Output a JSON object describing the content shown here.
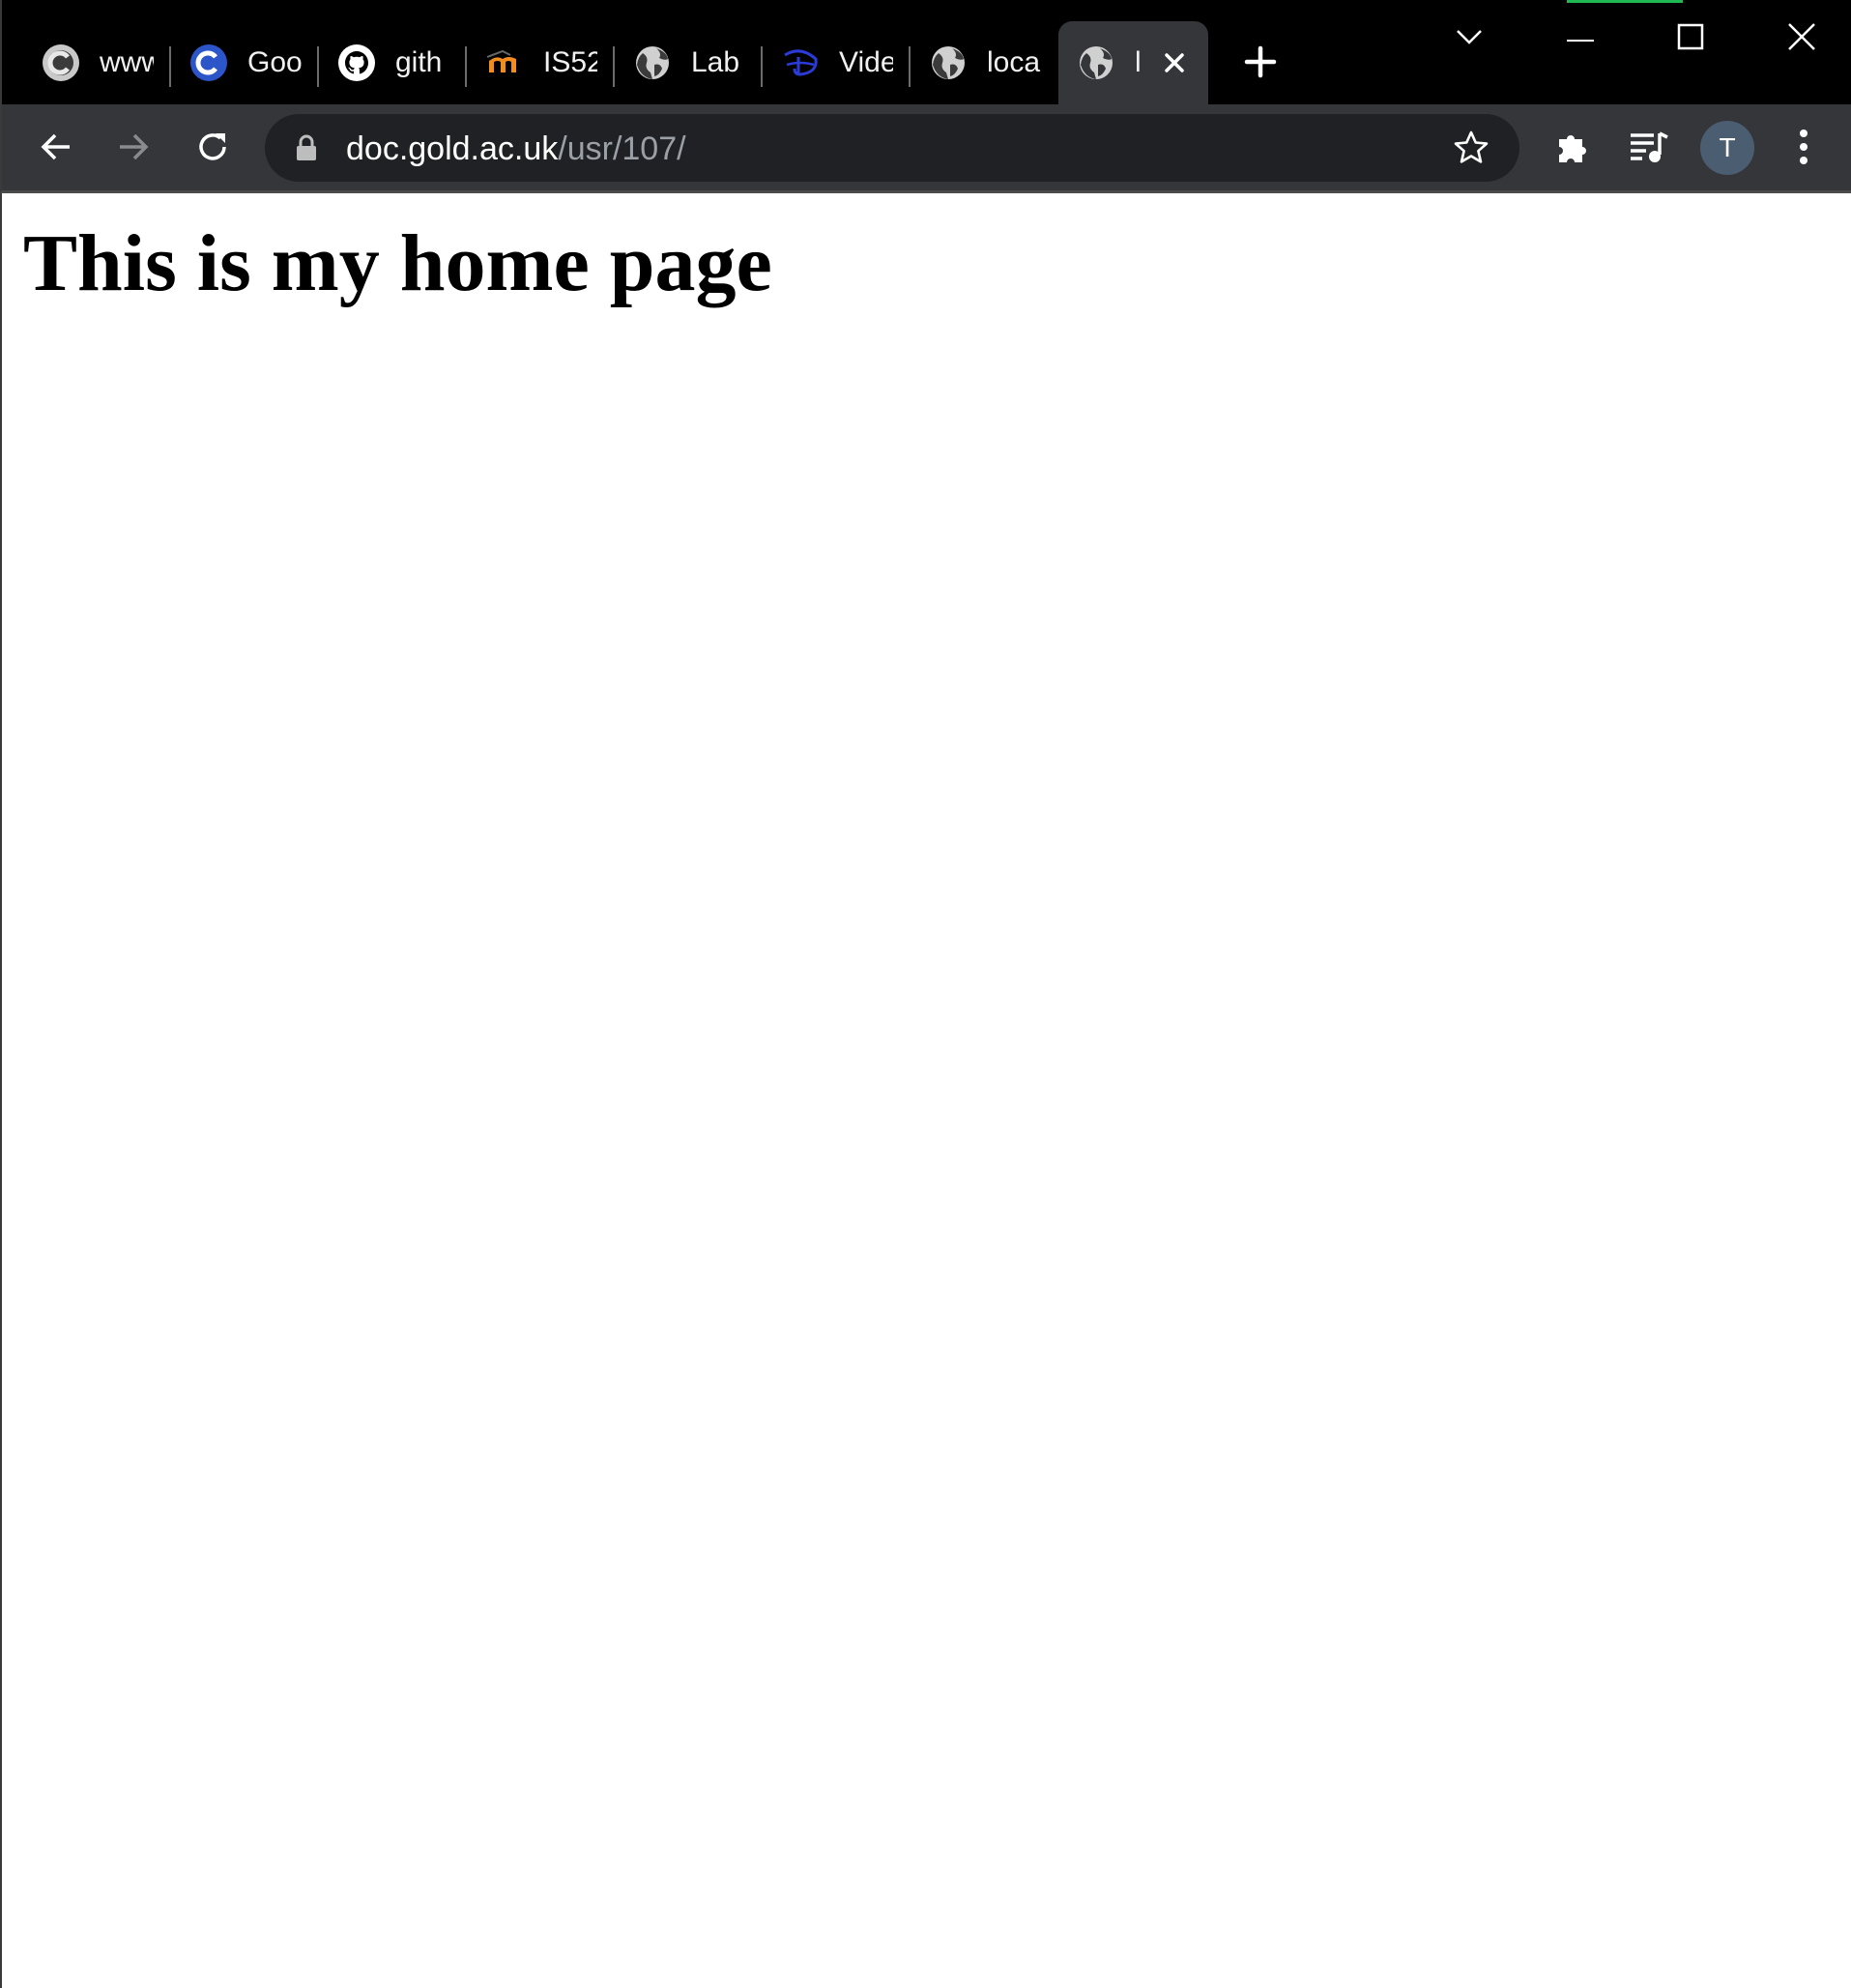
{
  "browser": {
    "tabs": [
      {
        "title": "www",
        "icon": "chrome-icon",
        "active": false
      },
      {
        "title": "Goo",
        "icon": "chrome-blue-icon",
        "active": false
      },
      {
        "title": "gith",
        "icon": "github-icon",
        "active": false
      },
      {
        "title": "IS52",
        "icon": "moodle-icon",
        "active": false
      },
      {
        "title": "Lab",
        "icon": "globe-icon",
        "active": false
      },
      {
        "title": "Vide",
        "icon": "disney-icon",
        "active": false
      },
      {
        "title": "loca",
        "icon": "globe-icon",
        "active": false
      },
      {
        "title": "l",
        "icon": "globe-icon",
        "active": true
      }
    ],
    "address": {
      "host": "doc.gold.ac.uk",
      "path": "/usr/107/"
    },
    "profile_initial": "T",
    "colors": {
      "tab_strip": "#000000",
      "toolbar": "#35363a",
      "omnibox": "#202124",
      "avatar": "#4b5d70",
      "green_indicator": "#1fb854"
    }
  },
  "page": {
    "heading": "This is my home page"
  }
}
